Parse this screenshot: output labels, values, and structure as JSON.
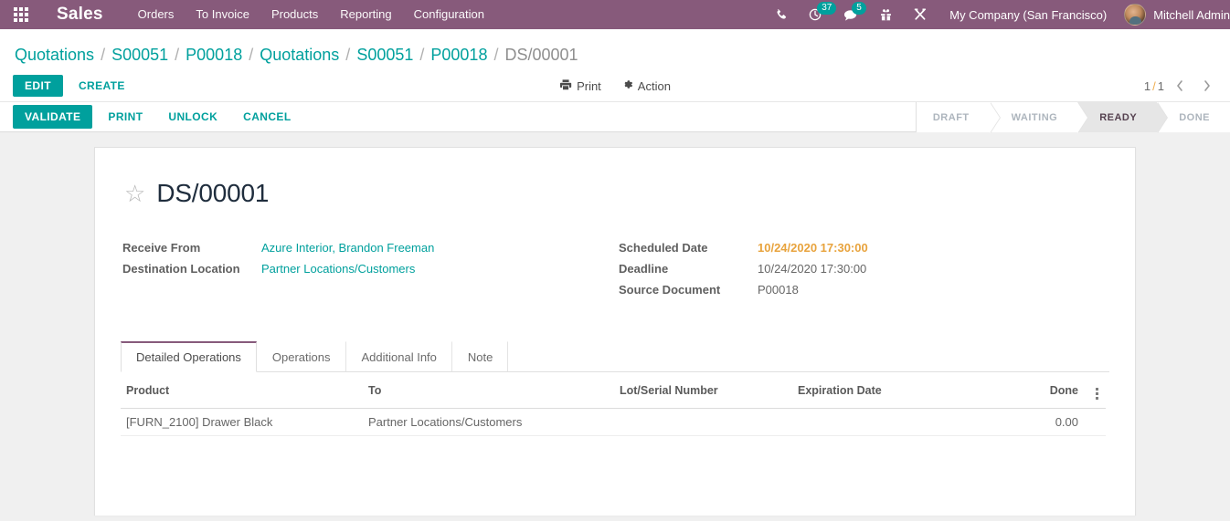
{
  "navbar": {
    "apps_icon": "apps-grid-icon",
    "brand": "Sales",
    "menus": [
      {
        "label": "Orders"
      },
      {
        "label": "To Invoice"
      },
      {
        "label": "Products"
      },
      {
        "label": "Reporting"
      },
      {
        "label": "Configuration"
      }
    ],
    "systray": {
      "phone_icon": "phone-icon",
      "activity_icon": "clock-activity-icon",
      "activity_count": "37",
      "messaging_icon": "chat-bubble-icon",
      "messaging_count": "5",
      "gift_icon": "gift-icon",
      "tools_icon": "crossed-tools-icon"
    },
    "company": "My Company (San Francisco)",
    "user_name": "Mitchell Admin",
    "avatar": "user-avatar"
  },
  "breadcrumb": {
    "items": [
      {
        "label": "Quotations",
        "current": false
      },
      {
        "label": "S00051",
        "current": false
      },
      {
        "label": "P00018",
        "current": false
      },
      {
        "label": "Quotations",
        "current": false
      },
      {
        "label": "S00051",
        "current": false
      },
      {
        "label": "P00018",
        "current": false
      },
      {
        "label": "DS/00001",
        "current": true
      }
    ],
    "separator": "/"
  },
  "control_panel": {
    "edit_label": "EDIT",
    "create_label": "CREATE",
    "print_label": "Print",
    "print_icon": "printer-icon",
    "action_label": "Action",
    "action_icon": "gear-icon",
    "pager": {
      "current": "1",
      "separator": "/",
      "total": "1",
      "prev_icon": "chevron-left-icon",
      "next_icon": "chevron-right-icon"
    }
  },
  "statusbar": {
    "buttons": [
      {
        "label": "VALIDATE",
        "primary": true
      },
      {
        "label": "PRINT",
        "primary": false
      },
      {
        "label": "UNLOCK",
        "primary": false
      },
      {
        "label": "CANCEL",
        "primary": false
      }
    ],
    "stages": [
      {
        "label": "DRAFT",
        "active": false
      },
      {
        "label": "WAITING",
        "active": false
      },
      {
        "label": "READY",
        "active": true
      },
      {
        "label": "DONE",
        "active": false
      }
    ]
  },
  "record": {
    "favorite_icon": "star-outline-icon",
    "title": "DS/00001",
    "fields_left": [
      {
        "label": "Receive From",
        "value": "Azure Interior, Brandon Freeman",
        "style": "link"
      },
      {
        "label": "Destination Location",
        "value": "Partner Locations/Customers",
        "style": "link"
      }
    ],
    "fields_right": [
      {
        "label": "Scheduled Date",
        "value": "10/24/2020 17:30:00",
        "style": "warn"
      },
      {
        "label": "Deadline",
        "value": "10/24/2020 17:30:00",
        "style": "plain"
      },
      {
        "label": "Source Document",
        "value": "P00018",
        "style": "plain"
      }
    ]
  },
  "notebook": {
    "tabs": [
      {
        "label": "Detailed Operations",
        "active": true
      },
      {
        "label": "Operations",
        "active": false
      },
      {
        "label": "Additional Info",
        "active": false
      },
      {
        "label": "Note",
        "active": false
      }
    ],
    "table": {
      "columns": [
        "Product",
        "To",
        "Lot/Serial Number",
        "Expiration Date",
        "Done"
      ],
      "optional_columns_icon": "vertical-dots-icon",
      "rows": [
        {
          "product": "[FURN_2100] Drawer Black",
          "to": "Partner Locations/Customers",
          "lot_serial": "",
          "expiration_date": "",
          "done": "0.00"
        }
      ]
    }
  },
  "colors": {
    "brand_purple": "#875A7B",
    "accent_teal": "#00A09D",
    "warning_orange": "#e8a33d",
    "page_background": "#f0f0f0"
  }
}
